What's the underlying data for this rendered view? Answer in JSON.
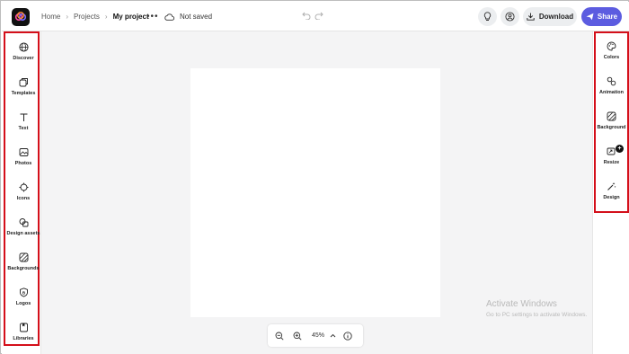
{
  "header": {
    "breadcrumb": {
      "home": "Home",
      "projects": "Projects",
      "current": "My project"
    },
    "more": "•••",
    "save_status": "Not saved",
    "download_label": "Download",
    "share_label": "Share"
  },
  "left_rail": {
    "items": [
      {
        "label": "Discover",
        "icon": "globe-icon"
      },
      {
        "label": "Templates",
        "icon": "templates-icon"
      },
      {
        "label": "Text",
        "icon": "text-icon"
      },
      {
        "label": "Photos",
        "icon": "photos-icon"
      },
      {
        "label": "Icons",
        "icon": "icons-icon"
      },
      {
        "label": "Design assets",
        "icon": "design-assets-icon"
      },
      {
        "label": "Backgrounds",
        "icon": "backgrounds-icon"
      },
      {
        "label": "Logos",
        "icon": "logos-icon"
      },
      {
        "label": "Libraries",
        "icon": "libraries-icon"
      }
    ]
  },
  "right_rail": {
    "items": [
      {
        "label": "Colors",
        "icon": "palette-icon"
      },
      {
        "label": "Animation",
        "icon": "animation-icon"
      },
      {
        "label": "Background",
        "icon": "background-icon"
      },
      {
        "label": "Resize",
        "icon": "resize-icon"
      },
      {
        "label": "Design",
        "icon": "magic-wand-icon"
      }
    ]
  },
  "zoom": {
    "level": "45%"
  },
  "watermark": {
    "title": "Activate Windows",
    "subtitle": "Go to PC settings to activate Windows."
  },
  "colors": {
    "accent": "#5c5ce0",
    "highlight_border": "#d40f1a",
    "stage": "#f4f4f5"
  }
}
